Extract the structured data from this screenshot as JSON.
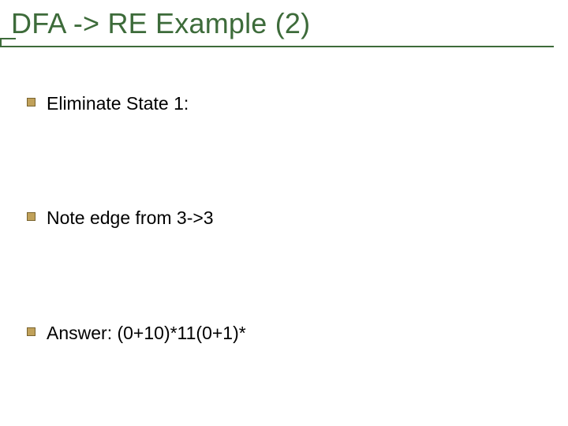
{
  "title": "DFA -> RE Example (2)",
  "bullets": [
    {
      "text": "Eliminate State 1:"
    },
    {
      "text": "Note edge from 3->3"
    },
    {
      "text": "Answer:  (0+10)*11(0+1)*"
    }
  ]
}
